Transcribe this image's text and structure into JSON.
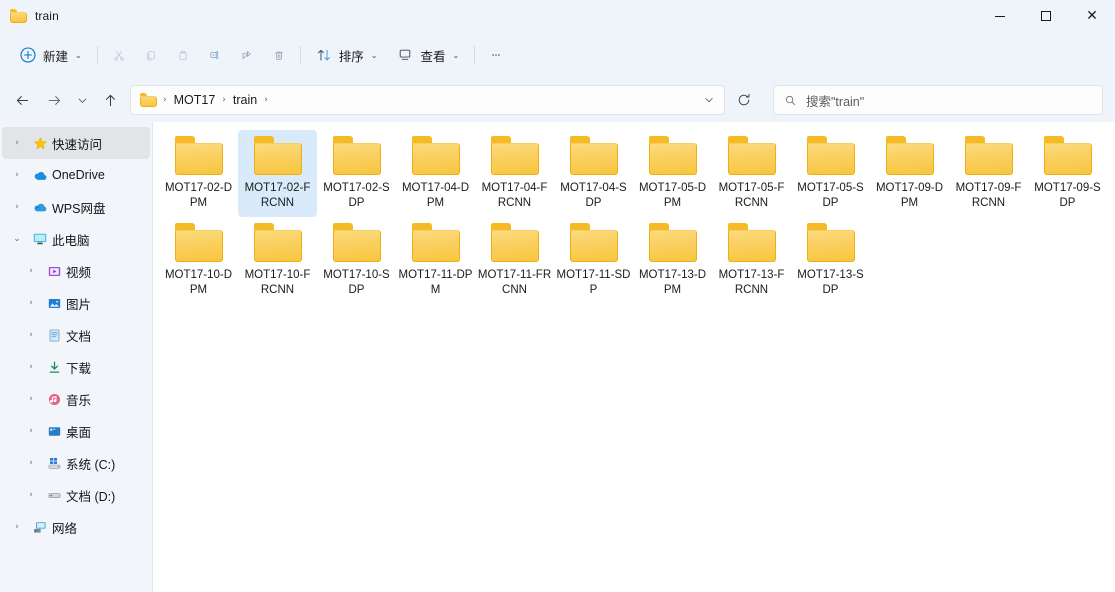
{
  "window": {
    "title": "train",
    "title_icon": "folder-icon",
    "controls": {
      "minimize": "minimize-icon",
      "maximize": "maximize-icon",
      "close": "close-icon"
    }
  },
  "toolbar": {
    "new_label": "新建",
    "new_icon": "plus-circle-icon",
    "cut_icon": "scissors-icon",
    "copy_icon": "copy-icon",
    "paste_icon": "paste-icon",
    "rename_icon": "rename-icon",
    "share_icon": "share-icon",
    "delete_icon": "trash-icon",
    "sort_label": "排序",
    "sort_icon": "sort-icon",
    "view_label": "查看",
    "view_icon": "view-icon",
    "more_label": "…",
    "more_icon": "ellipsis-icon",
    "chevron": "⌄"
  },
  "nav": {
    "back_icon": "arrow-left-icon",
    "forward_icon": "arrow-right-icon",
    "recent_icon": "chevron-down-icon",
    "up_icon": "arrow-up-icon",
    "refresh_icon": "refresh-icon",
    "address_dropdown_icon": "chevron-down-icon",
    "breadcrumb_icon": "folder-icon",
    "breadcrumbs": [
      "MOT17",
      "train"
    ],
    "separator": "›"
  },
  "search": {
    "icon": "search-icon",
    "placeholder": "搜索\"train\""
  },
  "sidebar": {
    "items": [
      {
        "label": "快速访问",
        "icon": "star-icon",
        "expander": "›",
        "indent": false,
        "active": true
      },
      {
        "label": "OneDrive",
        "icon": "cloud-icon",
        "expander": "›",
        "indent": false,
        "active": false
      },
      {
        "label": "WPS网盘",
        "icon": "wps-cloud-icon",
        "expander": "›",
        "indent": false,
        "active": false
      },
      {
        "label": "此电脑",
        "icon": "this-pc-icon",
        "expander": "⌄",
        "indent": false,
        "active": false
      },
      {
        "label": "视频",
        "icon": "videos-icon",
        "expander": "›",
        "indent": true,
        "active": false
      },
      {
        "label": "图片",
        "icon": "pictures-icon",
        "expander": "›",
        "indent": true,
        "active": false
      },
      {
        "label": "文档",
        "icon": "documents-icon",
        "expander": "›",
        "indent": true,
        "active": false
      },
      {
        "label": "下载",
        "icon": "downloads-icon",
        "expander": "›",
        "indent": true,
        "active": false
      },
      {
        "label": "音乐",
        "icon": "music-icon",
        "expander": "›",
        "indent": true,
        "active": false
      },
      {
        "label": "桌面",
        "icon": "desktop-icon",
        "expander": "›",
        "indent": true,
        "active": false
      },
      {
        "label": "系统 (C:)",
        "icon": "windows-drive-icon",
        "expander": "›",
        "indent": true,
        "active": false
      },
      {
        "label": "文档 (D:)",
        "icon": "drive-icon",
        "expander": "›",
        "indent": true,
        "active": false
      },
      {
        "label": "网络",
        "icon": "network-icon",
        "expander": "›",
        "indent": false,
        "active": false
      }
    ]
  },
  "content": {
    "items": [
      {
        "name": "MOT17-02-DPM",
        "icon": "folder-icon",
        "selected": false
      },
      {
        "name": "MOT17-02-FRCNN",
        "icon": "folder-icon",
        "selected": true
      },
      {
        "name": "MOT17-02-SDP",
        "icon": "folder-icon",
        "selected": false
      },
      {
        "name": "MOT17-04-DPM",
        "icon": "folder-icon",
        "selected": false
      },
      {
        "name": "MOT17-04-FRCNN",
        "icon": "folder-icon",
        "selected": false
      },
      {
        "name": "MOT17-04-SDP",
        "icon": "folder-icon",
        "selected": false
      },
      {
        "name": "MOT17-05-DPM",
        "icon": "folder-icon",
        "selected": false
      },
      {
        "name": "MOT17-05-FRCNN",
        "icon": "folder-icon",
        "selected": false
      },
      {
        "name": "MOT17-05-SDP",
        "icon": "folder-icon",
        "selected": false
      },
      {
        "name": "MOT17-09-DPM",
        "icon": "folder-icon",
        "selected": false
      },
      {
        "name": "MOT17-09-FRCNN",
        "icon": "folder-icon",
        "selected": false
      },
      {
        "name": "MOT17-09-SDP",
        "icon": "folder-icon",
        "selected": false
      },
      {
        "name": "MOT17-10-DPM",
        "icon": "folder-icon",
        "selected": false
      },
      {
        "name": "MOT17-10-FRCNN",
        "icon": "folder-icon",
        "selected": false
      },
      {
        "name": "MOT17-10-SDP",
        "icon": "folder-icon",
        "selected": false
      },
      {
        "name": "MOT17-11-DPM",
        "icon": "folder-icon",
        "selected": false
      },
      {
        "name": "MOT17-11-FRCNN",
        "icon": "folder-icon",
        "selected": false
      },
      {
        "name": "MOT17-11-SDP",
        "icon": "folder-icon",
        "selected": false
      },
      {
        "name": "MOT17-13-DPM",
        "icon": "folder-icon",
        "selected": false
      },
      {
        "name": "MOT17-13-FRCNN",
        "icon": "folder-icon",
        "selected": false
      },
      {
        "name": "MOT17-13-SDP",
        "icon": "folder-icon",
        "selected": false
      }
    ]
  },
  "colors": {
    "chrome": "#eff3fa",
    "sidebar": "#f2f5fa",
    "content": "#ffffff",
    "selection": "#d9ebfb",
    "folder_yellow": "#fad165",
    "accent": "#0078d4"
  }
}
